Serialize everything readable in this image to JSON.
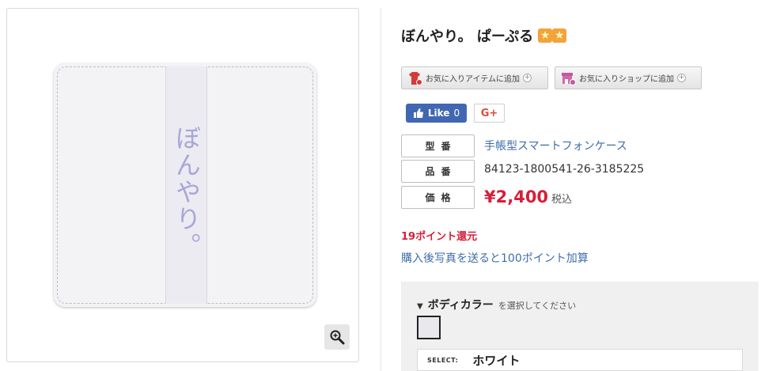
{
  "product": {
    "title": "ぼんやり。 ぱーぷる",
    "image_text": "ぼんやり。",
    "rating_icons": [
      "star-badge-icon",
      "star-badge-icon"
    ]
  },
  "buttons": {
    "fav_item": "お気に入りアイテムに追加",
    "fav_shop": "お気に入りショップに追加",
    "fb_like": "Like",
    "fb_count": "0",
    "gplus": "G+"
  },
  "specs": {
    "model_label": "型番",
    "model_value": "手帳型スマートフォンケース",
    "item_label": "品番",
    "item_value": "84123-1800541-26-3185225",
    "price_label": "価格",
    "price_value": "¥2,400",
    "tax_note": "税込"
  },
  "points": {
    "reward": "19ポイント還元",
    "photo_bonus": "購入後写真を送ると100ポイント加算"
  },
  "option": {
    "name": "ボディカラー",
    "hint": "を選択してください",
    "select_label": "SELECT:",
    "selected_value": "ホワイト",
    "swatch_color": "#e8e8ed"
  },
  "colors": {
    "accent_red": "#d61f3a",
    "link_blue": "#3d6ea8",
    "facebook": "#4267b2"
  }
}
